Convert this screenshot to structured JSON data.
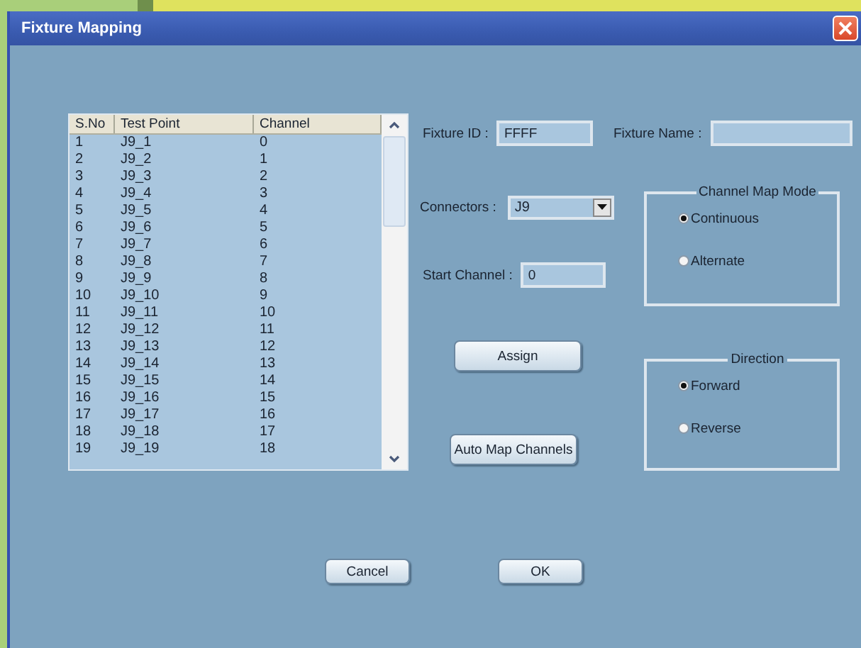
{
  "window": {
    "title": "Fixture Mapping"
  },
  "table": {
    "columns": [
      "S.No",
      "Test Point",
      "Channel"
    ],
    "rows": [
      [
        "1",
        "J9_1",
        "0"
      ],
      [
        "2",
        "J9_2",
        "1"
      ],
      [
        "3",
        "J9_3",
        "2"
      ],
      [
        "4",
        "J9_4",
        "3"
      ],
      [
        "5",
        "J9_5",
        "4"
      ],
      [
        "6",
        "J9_6",
        "5"
      ],
      [
        "7",
        "J9_7",
        "6"
      ],
      [
        "8",
        "J9_8",
        "7"
      ],
      [
        "9",
        "J9_9",
        "8"
      ],
      [
        "10",
        "J9_10",
        "9"
      ],
      [
        "11",
        "J9_11",
        "10"
      ],
      [
        "12",
        "J9_12",
        "11"
      ],
      [
        "13",
        "J9_13",
        "12"
      ],
      [
        "14",
        "J9_14",
        "13"
      ],
      [
        "15",
        "J9_15",
        "14"
      ],
      [
        "16",
        "J9_16",
        "15"
      ],
      [
        "17",
        "J9_17",
        "16"
      ],
      [
        "18",
        "J9_18",
        "17"
      ],
      [
        "19",
        "J9_19",
        "18"
      ]
    ]
  },
  "fixture_id": {
    "label": "Fixture ID :",
    "value": "FFFF"
  },
  "fixture_name": {
    "label": "Fixture Name :"
  },
  "connectors": {
    "label": "Connectors :",
    "value": "J9"
  },
  "start_channel": {
    "label": "Start Channel :",
    "value": "0"
  },
  "channel_map_mode": {
    "title": "Channel Map Mode",
    "options": [
      {
        "label": "Continuous",
        "selected": true
      },
      {
        "label": "Alternate",
        "selected": false
      }
    ]
  },
  "direction": {
    "title": "Direction",
    "options": [
      {
        "label": "Forward",
        "selected": true
      },
      {
        "label": "Reverse",
        "selected": false
      }
    ]
  },
  "assign_button": "Assign",
  "auto_map_button": "Auto Map Channels",
  "buttons": [
    "Cancel",
    "OK"
  ]
}
